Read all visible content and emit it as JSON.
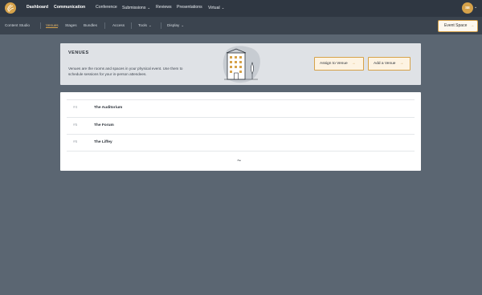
{
  "topnav": {
    "items": [
      {
        "label": "Dashboard",
        "bold": true
      },
      {
        "label": "Communication",
        "bold": true
      },
      {
        "label": "Conference",
        "bold": false
      },
      {
        "label": "Submissions",
        "bold": false,
        "dropdown": true
      },
      {
        "label": "Reviews",
        "bold": false
      },
      {
        "label": "Presentations",
        "bold": false
      },
      {
        "label": "Virtual",
        "bold": false,
        "dropdown": true
      }
    ],
    "avatar_initials": "SE",
    "caret": "⌄"
  },
  "subnav": {
    "items": [
      {
        "label": "Content Studio"
      },
      {
        "label": "Venues",
        "active": true
      },
      {
        "label": "Stages"
      },
      {
        "label": "Bundles"
      },
      {
        "label": "Access"
      },
      {
        "label": "Tools",
        "dropdown": true
      },
      {
        "label": "Display",
        "dropdown": true
      }
    ],
    "event_space_label": "Event Space",
    "arrow": "→"
  },
  "hero": {
    "title": "VENUES",
    "description": "Venues are the rooms and spaces in your physical event. Use them to schedule sessions for your in-person attendees.",
    "assign_label": "Assign to Venue",
    "add_label": "Add a Venue",
    "arrow": "→"
  },
  "venues": [
    {
      "id": "#4",
      "name": "The Auditorium"
    },
    {
      "id": "#5",
      "name": "The Forum"
    },
    {
      "id": "#6",
      "name": "The Liffey"
    }
  ],
  "loading_glyph": "~",
  "colors": {
    "accent": "#d6a24a",
    "topbar": "#2f3742",
    "subbar": "#3b444f",
    "background": "#5b6672"
  }
}
